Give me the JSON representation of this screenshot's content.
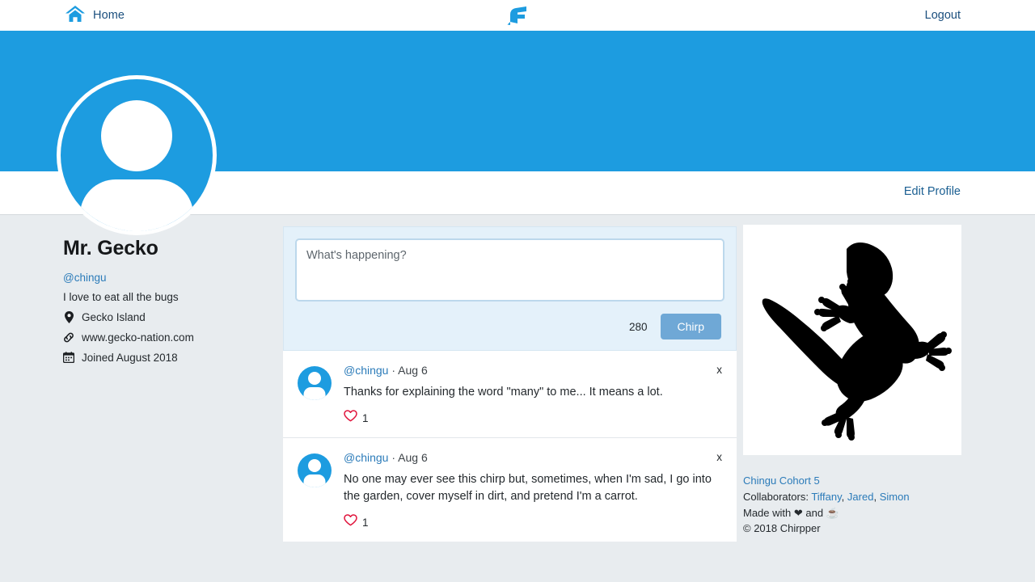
{
  "navbar": {
    "home_label": "Home",
    "home_icon": "home-icon",
    "logo_icon": "chirpper-bird-logo",
    "logout_label": "Logout"
  },
  "profile_bar": {
    "edit_profile_label": "Edit Profile"
  },
  "profile": {
    "avatar_icon": "user-avatar-icon",
    "name": "Mr. Gecko",
    "handle": "@chingu",
    "bio": "I love to eat all the bugs",
    "meta": [
      {
        "icon": "map-pin-icon",
        "label": "Gecko Island"
      },
      {
        "icon": "link-icon",
        "label": "www.gecko-nation.com"
      },
      {
        "icon": "calendar-icon",
        "label": "Joined August 2018"
      }
    ]
  },
  "composer": {
    "placeholder": "What's happening?",
    "value": "",
    "char_count": "280",
    "submit_label": "Chirp"
  },
  "chirps": [
    {
      "avatar_icon": "user-avatar-icon",
      "user": "@chingu",
      "separator": "·",
      "date": "Aug 6",
      "text": "Thanks for explaining the word \"many\" to me... It means a lot.",
      "like_icon": "heart-outline-icon",
      "likes": "1",
      "delete_label": "x"
    },
    {
      "avatar_icon": "user-avatar-icon",
      "user": "@chingu",
      "separator": "·",
      "date": "Aug 6",
      "text": "No one may ever see this chirp but, sometimes, when I'm sad, I go into the garden, cover myself in dirt, and pretend I'm a carrot.",
      "like_icon": "heart-outline-icon",
      "likes": "1",
      "delete_label": "x"
    }
  ],
  "sidebar": {
    "image_icon": "gecko-silhouette-image",
    "cohort_label": "Chingu Cohort 5",
    "collaborators_label": "Collaborators:",
    "collaborators": [
      "Tiffany",
      "Jared",
      "Simon"
    ],
    "collab_sep_1": ",",
    "collab_sep_2": ",",
    "made_with_prefix": "Made with",
    "heart_icon": "heart-solid-icon",
    "made_with_join": "and",
    "coffee_icon": "coffee-cup-icon",
    "copyright": "© 2018 Chirpper"
  },
  "colors": {
    "brand_blue": "#1d9ce0",
    "link_blue": "#2b7bb9",
    "page_bg": "#e8ecef",
    "composer_bg": "#e4f1fa",
    "button_blue": "#6fa8d6",
    "heart_red": "#e0143c"
  }
}
